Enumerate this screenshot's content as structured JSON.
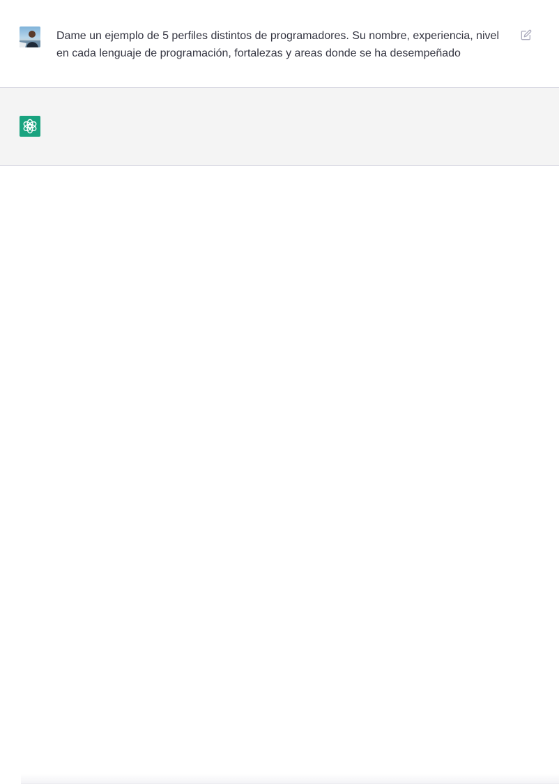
{
  "theme": {
    "brand_color": "#19a37f",
    "user_bg": "#ffffff",
    "assistant_bg": "#f4f4f4"
  },
  "conversation": {
    "user_message": {
      "avatar": "user-photo-avatar",
      "text": "Dame un ejemplo de 5 perfiles distintos de programadores. Su nombre, experiencia, nivel en cada lenguaje de programación, fortalezas y areas donde se ha desempeñado",
      "action_icon": "edit-icon"
    },
    "assistant_message": {
      "avatar": "openai-logo-icon",
      "text": ""
    }
  }
}
